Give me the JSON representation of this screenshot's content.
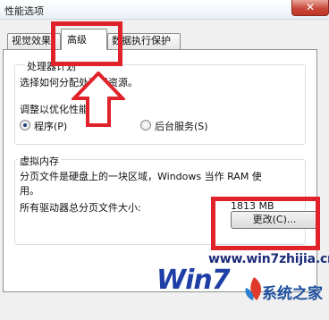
{
  "window": {
    "title": "性能选项",
    "close_label": "✕"
  },
  "tabs": [
    {
      "label": "视觉效果"
    },
    {
      "label": "高级"
    },
    {
      "label": "数据执行保护"
    }
  ],
  "processor": {
    "legend": "处理器计划",
    "description": "选择如何分配处理器资源。",
    "adjust_label": "调整以优化性能:",
    "option_programs": "程序(P)",
    "option_services": "后台服务(S)",
    "selected": "程序(P)"
  },
  "virtual_memory": {
    "legend": "虚拟内存",
    "description_line1": "分页文件是硬盘上的一块区域，Windows 当作 RAM 使",
    "description_line2": "用。",
    "total_label": "所有驱动器总分页文件大小:",
    "total_value": "1813 MB",
    "change_button": "更改(C)..."
  },
  "watermark": {
    "url": "www.win7zhijia.cn",
    "logo": "Win7",
    "site": "系统之家"
  },
  "colors": {
    "highlight": "#e0222a",
    "arrow": "#e0222a"
  }
}
